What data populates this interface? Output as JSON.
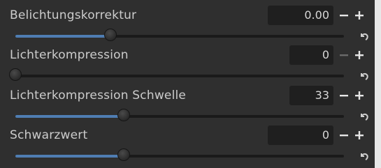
{
  "colors": {
    "background": "#2f2f2f",
    "track": "#1a1a1a",
    "track_fill": "#4f7db2",
    "value_box": "#1f1f1f",
    "text": "#cccccc",
    "plus_enabled": "#e6e6e6",
    "minus_disabled": "#6a6a6a"
  },
  "sliders": [
    {
      "label": "Belichtungskorrektur",
      "value_text": "0.00",
      "level": 0.29,
      "minus_disabled": false,
      "decrease_icon": "minus-icon",
      "increase_icon": "plus-icon",
      "reset_icon": "reset-undo-icon"
    },
    {
      "label": "Lichterkompression",
      "value_text": "0",
      "level": 0.0,
      "minus_disabled": true,
      "decrease_icon": "minus-icon",
      "increase_icon": "plus-icon",
      "reset_icon": "reset-undo-icon"
    },
    {
      "label": "Lichterkompression Schwelle",
      "value_text": "33",
      "level": 0.33,
      "minus_disabled": false,
      "decrease_icon": "minus-icon",
      "increase_icon": "plus-icon",
      "reset_icon": "reset-undo-icon"
    },
    {
      "label": "Schwarzwert",
      "value_text": "0",
      "level": 0.33,
      "minus_disabled": false,
      "decrease_icon": "minus-icon",
      "increase_icon": "plus-icon",
      "reset_icon": "reset-undo-icon"
    }
  ]
}
